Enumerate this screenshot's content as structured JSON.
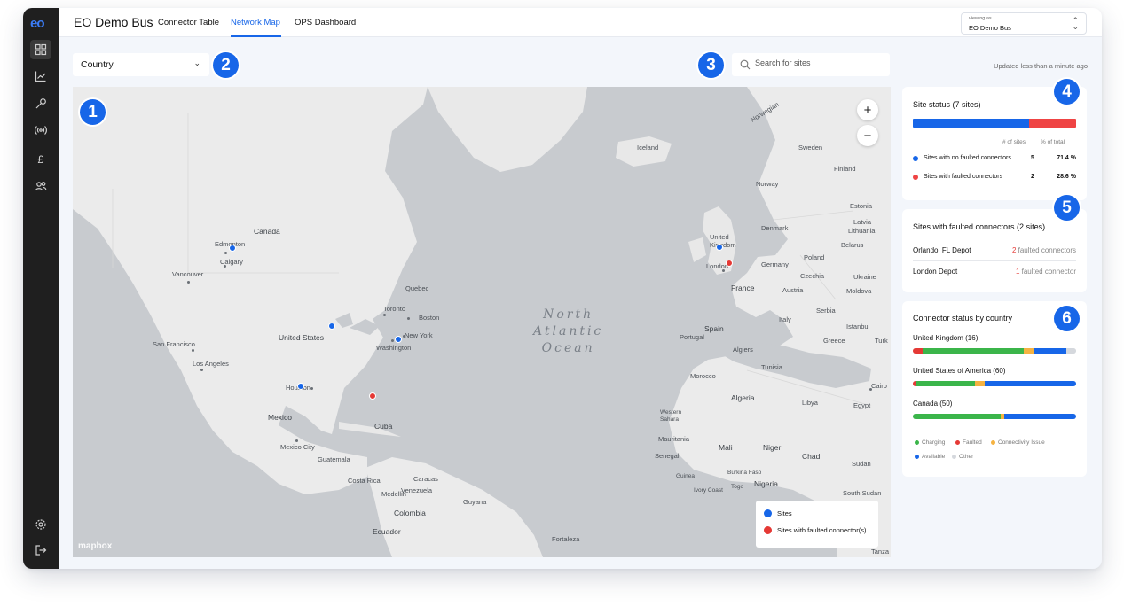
{
  "sidebar": {
    "logo": "eo",
    "icons": [
      "dashboard-icon",
      "chart-icon",
      "wrench-icon",
      "signal-icon",
      "pound-icon",
      "users-icon",
      "settings-icon",
      "logout-icon"
    ]
  },
  "header": {
    "app_title": "EO Demo Bus",
    "tabs": [
      {
        "label": "Connector Table"
      },
      {
        "label": "Network Map"
      },
      {
        "label": "OPS Dashboard"
      }
    ],
    "active_tab": "Network Map",
    "viewing_as": {
      "label": "viewing as",
      "value": "EO Demo Bus"
    }
  },
  "controls": {
    "country_select": {
      "value": "Country"
    },
    "search": {
      "placeholder": "Search for sites",
      "value": ""
    },
    "updated_text": "Updated less than a minute ago"
  },
  "badges": [
    "1",
    "2",
    "3",
    "4",
    "5",
    "6"
  ],
  "map": {
    "ocean_label": [
      "North",
      "Atlantic",
      "Ocean"
    ],
    "place_labels": [
      "Canada",
      "Edmonton",
      "Calgary",
      "Vancouver",
      "Quebec",
      "Toronto",
      "Boston",
      "New York",
      "Washington",
      "United States",
      "San Francisco",
      "Los Angeles",
      "Houston",
      "Mexico",
      "Mexico City",
      "Guatemala",
      "Cuba",
      "Costa Rica",
      "Medellin",
      "Caracas",
      "Venezuela",
      "Guyana",
      "Colombia",
      "Ecuador",
      "Fortaleza",
      "Iceland",
      "Norwegian",
      "Sweden",
      "Finland",
      "Norway",
      "Estonia",
      "Latvia",
      "Lithuania",
      "Denmark",
      "Belarus",
      "United Kingdom",
      "London",
      "Germany",
      "Poland",
      "Czechia",
      "Ukraine",
      "France",
      "Austria",
      "Moldova",
      "Serbia",
      "Italy",
      "Istanbul",
      "Spain",
      "Portugal",
      "Greece",
      "Turk",
      "Algiers",
      "Tunisia",
      "Morocco",
      "Algeria",
      "Libya",
      "Egypt",
      "Cairo",
      "Western Sahara",
      "Mauritania",
      "Mali",
      "Niger",
      "Chad",
      "Sudan",
      "Senegal",
      "Burkina Faso",
      "Guinea",
      "Ivory Coast",
      "Togo",
      "Nigeria",
      "South Sudan",
      "Tanza"
    ],
    "zoom_in": "+",
    "zoom_out": "−",
    "attribution": "mapbox",
    "legend": [
      {
        "label": "Sites",
        "color": "#1766e8"
      },
      {
        "label": "Sites with faulted connector(s)",
        "color": "#e53935"
      }
    ],
    "sites": [
      {
        "name": "Edmonton",
        "faulted": false
      },
      {
        "name": "Chicago",
        "faulted": false
      },
      {
        "name": "Washington",
        "faulted": false
      },
      {
        "name": "Houston",
        "faulted": false
      },
      {
        "name": "Orlando, FL Depot",
        "faulted": true
      },
      {
        "name": "Manchester",
        "faulted": false
      },
      {
        "name": "London Depot",
        "faulted": true
      }
    ]
  },
  "site_status": {
    "title": "Site status (7 sites)",
    "col_sites": "# of sites",
    "col_pct": "% of total",
    "rows": [
      {
        "label": "Sites with no faulted connectors",
        "count": "5",
        "pct": "71.4 %",
        "fraction": 0.714,
        "color": "#1766e8"
      },
      {
        "label": "Sites with faulted connectors",
        "count": "2",
        "pct": "28.6 %",
        "fraction": 0.286,
        "color": "#ef4444"
      }
    ]
  },
  "faulted_sites": {
    "title": "Sites with faulted connectors (2 sites)",
    "rows": [
      {
        "name": "Orlando, FL Depot",
        "count": "2",
        "suffix": " faulted connectors"
      },
      {
        "name": "London Depot",
        "count": "1",
        "suffix": " faulted connector"
      }
    ]
  },
  "connector_status": {
    "title": "Connector status by country",
    "countries": [
      {
        "name": "United Kingdom (16)",
        "segments": [
          0.06,
          0.62,
          0.06,
          0.2,
          0.06
        ]
      },
      {
        "name": "United States of America (60)",
        "segments": [
          0.02,
          0.36,
          0.06,
          0.56,
          0.0
        ]
      },
      {
        "name": "Canada (50)",
        "segments": [
          0.0,
          0.54,
          0.02,
          0.44,
          0.0
        ]
      }
    ],
    "legend": [
      {
        "label": "Charging",
        "color": "#3bb54a"
      },
      {
        "label": "Faulted",
        "color": "#e53935"
      },
      {
        "label": "Connectivity Issue",
        "color": "#f5b342"
      },
      {
        "label": "Available",
        "color": "#1766e8"
      },
      {
        "label": "Other",
        "color": "#d5d8dd"
      }
    ]
  }
}
